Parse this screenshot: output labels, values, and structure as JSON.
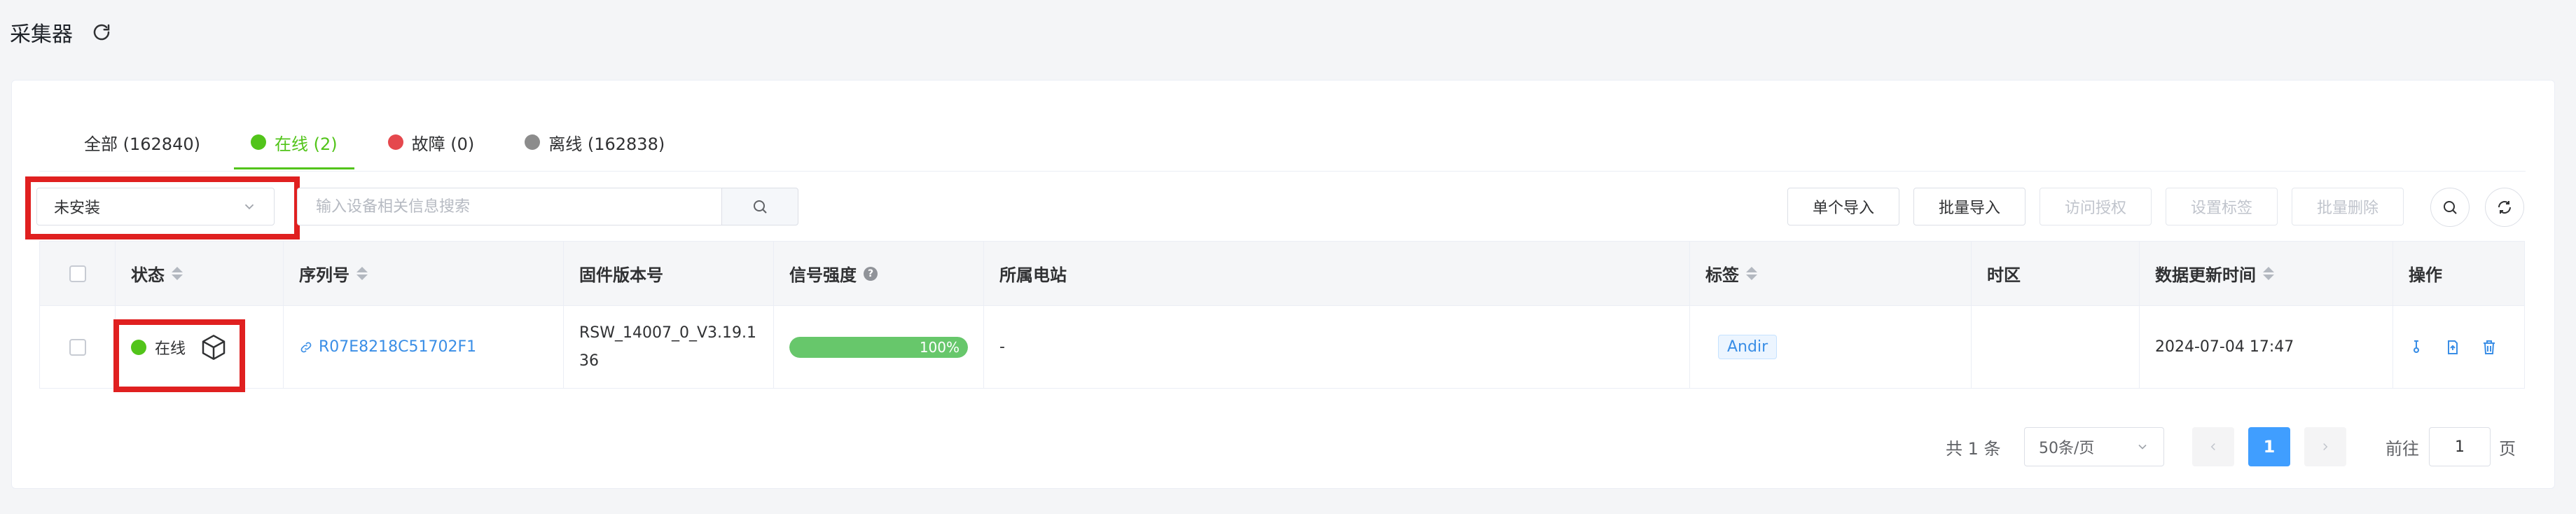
{
  "header": {
    "title": "采集器",
    "refresh_icon": "refresh-icon"
  },
  "tabs": [
    {
      "label": "全部 (162840)",
      "dot": null,
      "active": false
    },
    {
      "label": "在线 (2)",
      "dot": "#52c41a",
      "active": true
    },
    {
      "label": "故障 (0)",
      "dot": "#e5484d",
      "active": false
    },
    {
      "label": "离线 (162838)",
      "dot": "#8c8c8c",
      "active": false
    }
  ],
  "toolbar": {
    "install_select_value": "未安装",
    "search_placeholder": "输入设备相关信息搜索",
    "buttons": {
      "single_import": "单个导入",
      "batch_import": "批量导入",
      "access_auth": "访问授权",
      "set_tags": "设置标签",
      "batch_delete": "批量删除"
    }
  },
  "table": {
    "columns": {
      "status": "状态",
      "serial": "序列号",
      "firmware": "固件版本号",
      "signal": "信号强度",
      "station": "所属电站",
      "tags": "标签",
      "timezone": "时区",
      "updated": "数据更新时间",
      "actions": "操作"
    },
    "rows": [
      {
        "status": "在线",
        "serial": "R07E8218C51702F1",
        "firmware_line1": "RSW_14007_0_V3.19.1",
        "firmware_line2": "36",
        "signal_label": "100%",
        "signal_value": 100,
        "station": "-",
        "tag": "Andir",
        "timezone": "",
        "updated": "2024-07-04 17:47"
      }
    ]
  },
  "pagination": {
    "total": "共 1 条",
    "page_size": "50条/页",
    "current_page": "1",
    "goto_label": "前往",
    "goto_value": "1",
    "page_suffix": "页"
  },
  "colors": {
    "accent": "#409eff",
    "online": "#52c41a",
    "highlight": "#e02020"
  }
}
